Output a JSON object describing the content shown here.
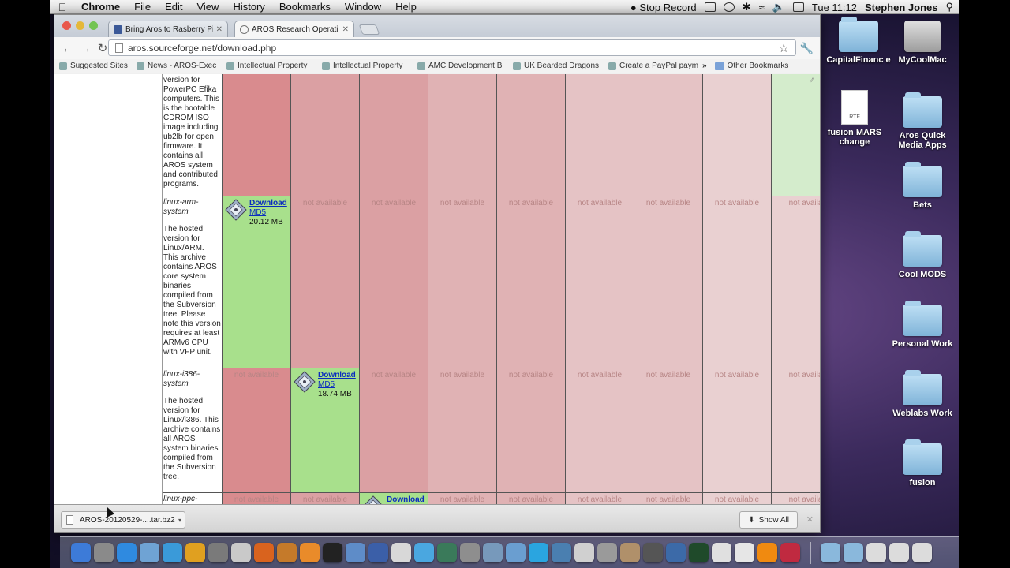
{
  "menubar": {
    "app": "Chrome",
    "items": [
      "File",
      "Edit",
      "View",
      "History",
      "Bookmarks",
      "Window",
      "Help"
    ],
    "status_stop": "Stop Record",
    "clock": "Tue 11:12",
    "user": "Stephen Jones"
  },
  "tabs": [
    {
      "title": "Bring Aros to Rasberry Pi (A",
      "favicon": "facebook-icon"
    },
    {
      "title": "AROS Research Operating Sy",
      "favicon": "globe-icon"
    }
  ],
  "url": "aros.sourceforge.net/download.php",
  "bookmarks": [
    "Suggested Sites",
    "News - AROS-Exec",
    "Intellectual Property",
    "Intellectual Property",
    "AMC Development B",
    "UK Bearded Dragons",
    "Create a PayPal paym"
  ],
  "bookmarks_more": "»",
  "other_bookmarks": "Other Bookmarks",
  "rows": [
    {
      "system": "",
      "description": "version for PowerPC Efika computers. This is the bootable CDROM ISO image including ub2lb for open firmware. It contains all AROS system and contributed programs.",
      "cells": [
        "",
        "",
        "",
        "",
        "",
        "",
        "",
        "",
        ""
      ]
    },
    {
      "system": "linux-arm-system",
      "description": "The hosted version for Linux/ARM. This archive contains AROS core system binaries compiled from the Subversion tree. Please note this version requires at least ARMv6 CPU with VFP unit.",
      "cells": [
        "download",
        "not available",
        "not available",
        "not available",
        "not available",
        "not available",
        "not available",
        "not available",
        "not availa"
      ],
      "download": {
        "link": "Download",
        "md5": "MD5",
        "size": "20.12 MB"
      }
    },
    {
      "system": "linux-i386-system",
      "description": "The hosted version for Linux/i386. This archive contains all AROS system binaries compiled from the Subversion tree.",
      "cells": [
        "not available",
        "download",
        "not available",
        "not available",
        "not available",
        "not available",
        "not available",
        "not available",
        "not availa"
      ],
      "download": {
        "link": "Download",
        "md5": "MD5",
        "size": "18.74 MB"
      }
    },
    {
      "system": "linux-ppc-",
      "description": "",
      "cells": [
        "not available",
        "not available",
        "download",
        "not available",
        "not available",
        "not available",
        "not available",
        "not available",
        "not availa"
      ],
      "download": {
        "link": "Download",
        "md5": "",
        "size": ""
      }
    }
  ],
  "shelf": {
    "file": "AROS-20120529-....tar.bz2",
    "show_all": "Show All"
  },
  "desktop": [
    {
      "label": "CapitalFinanc e",
      "type": "folder"
    },
    {
      "label": "MyCoolMac",
      "type": "hdd"
    },
    {
      "label": "fusion MARS change",
      "type": "rtf",
      "badge": "RTF"
    },
    {
      "label": "Aros Quick Media Apps",
      "type": "folder"
    },
    {
      "label": "Bets",
      "type": "folder"
    },
    {
      "label": "Cool MODS",
      "type": "folder"
    },
    {
      "label": "Personal Work",
      "type": "folder"
    },
    {
      "label": "Weblabs Work",
      "type": "folder"
    },
    {
      "label": "fusion",
      "type": "folder"
    }
  ],
  "colors": {
    "cell_red_1": "#d98b8e",
    "cell_red_2": "#dba0a3",
    "cell_red_3": "#e0b2b4",
    "cell_red_4": "#e5c3c5",
    "cell_red_5": "#e9d0d1",
    "cell_green": "#a8e08c",
    "cell_green_pale": "#d4eccc",
    "link": "#0a2cbf"
  }
}
